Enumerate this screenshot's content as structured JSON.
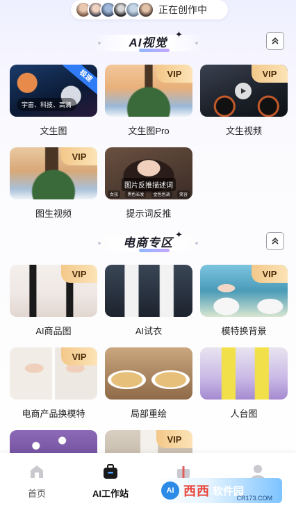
{
  "header": {
    "creating_text": "正在创作中",
    "avatar_count": 6
  },
  "sections": [
    {
      "title": "AI视觉",
      "items": [
        {
          "label": "文生图",
          "badge": "极速",
          "tag": "宇宙、科技、高清",
          "vip": false
        },
        {
          "label": "文生图Pro",
          "badge": "VIP",
          "vip": true
        },
        {
          "label": "文生视频",
          "badge": "VIP",
          "vip": true,
          "play": true
        },
        {
          "label": "图生视频",
          "badge": "VIP",
          "vip": true
        },
        {
          "label": "提示词反推",
          "overlay": "图片反推描述词",
          "mini_tags": [
            "女孩",
            "黑色长发",
            "金色色调",
            "笑容"
          ]
        }
      ]
    },
    {
      "title": "电商专区",
      "items": [
        {
          "label": "AI商品图",
          "badge": "VIP",
          "vip": true
        },
        {
          "label": "AI试衣",
          "vip": false
        },
        {
          "label": "模特换背景",
          "badge": "VIP",
          "vip": true
        },
        {
          "label": "电商产品换模特",
          "badge": "VIP",
          "vip": true
        },
        {
          "label": "局部重绘",
          "vip": false
        },
        {
          "label": "人台图",
          "vip": false
        },
        {
          "label": "",
          "vip": false
        },
        {
          "label": "",
          "badge": "VIP",
          "vip": true
        }
      ]
    }
  ],
  "tabbar": {
    "items": [
      {
        "label": "首页",
        "active": false
      },
      {
        "label": "AI工作站",
        "active": true
      },
      {
        "label": "",
        "active": false
      },
      {
        "label": "",
        "active": false
      }
    ]
  },
  "watermark": {
    "circle": "AI",
    "main": "西西",
    "sub": "软件园",
    "url": "CR173.COM"
  },
  "colors": {
    "vip_gold": "#f3c88a",
    "speed_blue": "#2f7cf6",
    "accent_gradient_start": "#8fb7ff",
    "accent_gradient_end": "#c7a6ff"
  }
}
